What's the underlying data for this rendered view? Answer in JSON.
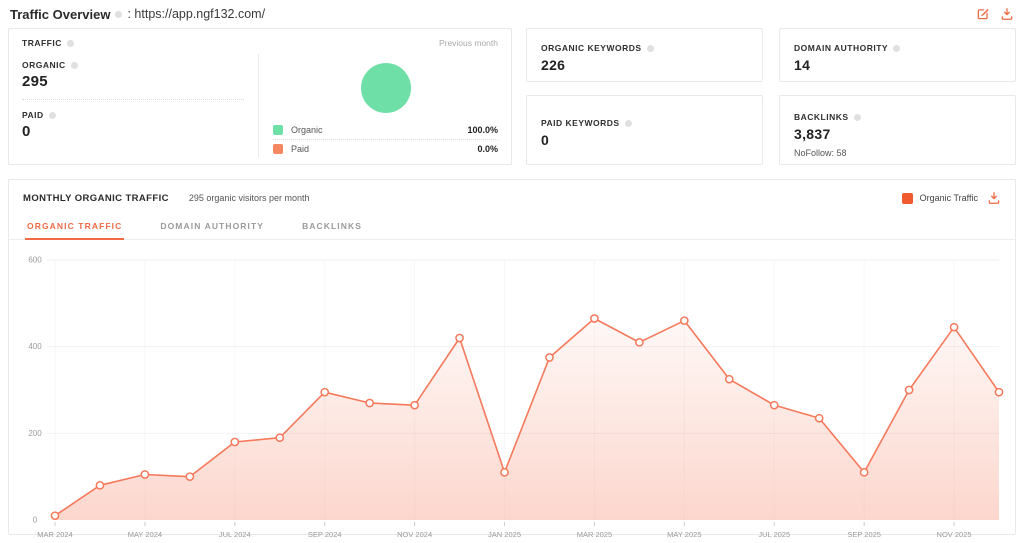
{
  "colors": {
    "accent_orange": "#f1592e",
    "line_coral": "#f5795a",
    "organic_green": "#6fdfa8",
    "paid_coral": "#f58763"
  },
  "header": {
    "title": "Traffic Overview",
    "separator": ":",
    "url": "https://app.ngf132.com/"
  },
  "traffic_card": {
    "title": "TRAFFIC",
    "previous_month_label": "Previous month",
    "organic_label": "ORGANIC",
    "organic_value": "295",
    "paid_label": "PAID",
    "paid_value": "0",
    "legend": [
      {
        "label": "Organic",
        "pct": "100.0%"
      },
      {
        "label": "Paid",
        "pct": "0.0%"
      }
    ]
  },
  "stats": [
    {
      "label": "ORGANIC KEYWORDS",
      "value": "226"
    },
    {
      "label": "DOMAIN AUTHORITY",
      "value": "14"
    },
    {
      "label": "PAID KEYWORDS",
      "value": "0"
    },
    {
      "label": "BACKLINKS",
      "value": "3,837",
      "sub": "NoFollow: 58"
    }
  ],
  "monthly": {
    "title": "MONTHLY ORGANIC TRAFFIC",
    "subtitle": "295 organic visitors per month",
    "legend_label": "Organic Traffic",
    "tabs": [
      {
        "label": "ORGANIC TRAFFIC",
        "active": true
      },
      {
        "label": "DOMAIN AUTHORITY",
        "active": false
      },
      {
        "label": "BACKLINKS",
        "active": false
      }
    ]
  },
  "chart_data": {
    "type": "area",
    "title": "MONTHLY ORGANIC TRAFFIC",
    "series_name": "Organic Traffic",
    "x": [
      "MAR 2024",
      "APR 2024",
      "MAY 2024",
      "JUN 2024",
      "JUL 2024",
      "AUG 2024",
      "SEP 2024",
      "OCT 2024",
      "NOV 2024",
      "DEC 2024",
      "JAN 2025",
      "FEB 2025",
      "MAR 2025",
      "APR 2025",
      "MAY 2025",
      "JUN 2025",
      "JUL 2025",
      "AUG 2025",
      "SEP 2025",
      "OCT 2025",
      "NOV 2025",
      "DEC 2025"
    ],
    "values": [
      10,
      80,
      105,
      100,
      180,
      190,
      295,
      270,
      265,
      420,
      110,
      375,
      465,
      410,
      460,
      325,
      265,
      235,
      110,
      300,
      445,
      295
    ],
    "label_every": 2,
    "xlabel": "",
    "ylabel": "",
    "ylim": [
      0,
      600
    ],
    "yticks": [
      0,
      200,
      400,
      600
    ],
    "grid": "horizontal",
    "legend_position": "top-right",
    "line_color": "#f5795a",
    "marker": "circle-open",
    "fill_gradient": [
      "rgba(245,121,90,0.05)",
      "rgba(245,121,90,0.30)"
    ]
  }
}
